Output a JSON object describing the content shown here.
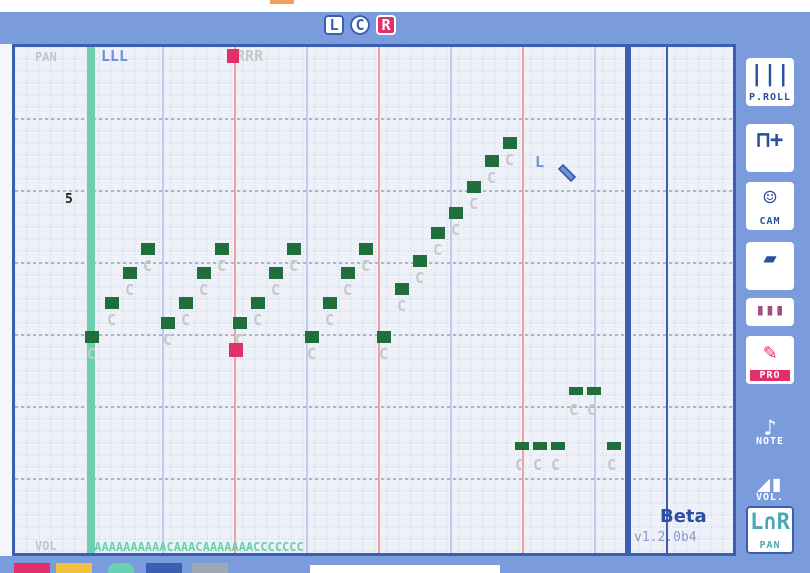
{
  "modes": [
    "L",
    "C",
    "R"
  ],
  "track": {
    "pan_label": "PAN",
    "vol_label": "VOL",
    "beat_marker": "5",
    "top_lanes": [
      "LLL",
      "RRRR"
    ],
    "vol_row": "CAAAAAAAAAACAAACAAAAAAACCCCCCC"
  },
  "tools": [
    {
      "name": "piano-roll",
      "glyph": "|||",
      "cap": "P.ROLL"
    },
    {
      "name": "note-add",
      "glyph": "⊓+",
      "cap": ""
    },
    {
      "name": "cam",
      "glyph": "☺",
      "cap": "CAM"
    },
    {
      "name": "eraser",
      "glyph": "▰",
      "cap": ""
    },
    {
      "name": "palette",
      "glyph": "▮▮▮",
      "cap": ""
    },
    {
      "name": "pro",
      "glyph": "✎",
      "cap": "PRO"
    },
    {
      "name": "note",
      "glyph": "♪",
      "cap": "NOTE"
    },
    {
      "name": "vol",
      "glyph": "◢▮",
      "cap": "VOL."
    },
    {
      "name": "pan",
      "glyph": "L∩R",
      "cap": "PAN"
    }
  ],
  "beta": "Beta",
  "version": "v1.2.0b4",
  "colors": {
    "accent": "#3a5fb0",
    "pink": "#e0306a",
    "teal": "#6ccfb0",
    "note": "#1f6e3c"
  }
}
